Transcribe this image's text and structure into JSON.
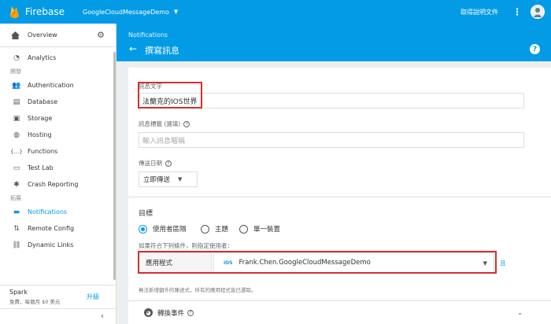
{
  "topbar": {
    "brand": "Firebase",
    "project": "GoogleCloudMessageDemo",
    "help": "取得說明文件",
    "kebab": "⋮"
  },
  "sidebar": {
    "overview": "Overview",
    "items": [
      {
        "label": "Analytics",
        "icon": "chart-icon"
      }
    ],
    "develop_label": "開發",
    "develop": [
      {
        "label": "Authentication",
        "icon": "people-icon"
      },
      {
        "label": "Database",
        "icon": "database-icon"
      },
      {
        "label": "Storage",
        "icon": "photo-icon"
      },
      {
        "label": "Hosting",
        "icon": "globe-icon"
      },
      {
        "label": "Functions",
        "icon": "functions-icon"
      },
      {
        "label": "Test Lab",
        "icon": "test-lab-icon"
      },
      {
        "label": "Crash Reporting",
        "icon": "bug-icon"
      }
    ],
    "grow_label": "拓展",
    "grow": [
      {
        "label": "Notifications",
        "icon": "chat-icon",
        "active": true
      },
      {
        "label": "Remote Config",
        "icon": "remote-config-icon"
      },
      {
        "label": "Dynamic Links",
        "icon": "link-icon"
      }
    ],
    "plan_name": "Spark",
    "plan_desc": "免費，每個月 $0 美元",
    "upgrade": "升級",
    "collapse": "‹"
  },
  "header": {
    "breadcrumb": "Notifications",
    "title": "撰寫訊息",
    "help": "?"
  },
  "form": {
    "message_text_label": "訊息文字",
    "message_text_value": "法蘭克的IOS世界",
    "message_title_label": "訊息標籤 (選填)",
    "message_title_placeholder": "輸入訊息暱稱",
    "send_date_label": "傳送日期",
    "send_date_value": "立即傳送",
    "target_title": "目標",
    "radios": [
      "使用者區隔",
      "主題",
      "單一裝置"
    ],
    "condition_label": "如果符合下列條件，則指定使用者：",
    "app_label": "應用程式",
    "platform_tag": "iOS",
    "app_value": "Frank.Chen.GoogleCloudMessageDemo",
    "and_link": "且",
    "hint": "無法新增額外的陳述式，所有的應用程式皆已選取。",
    "conversion_label": "轉換事件"
  },
  "colors": {
    "primary": "#039be5",
    "highlight": "#d32f2f"
  }
}
